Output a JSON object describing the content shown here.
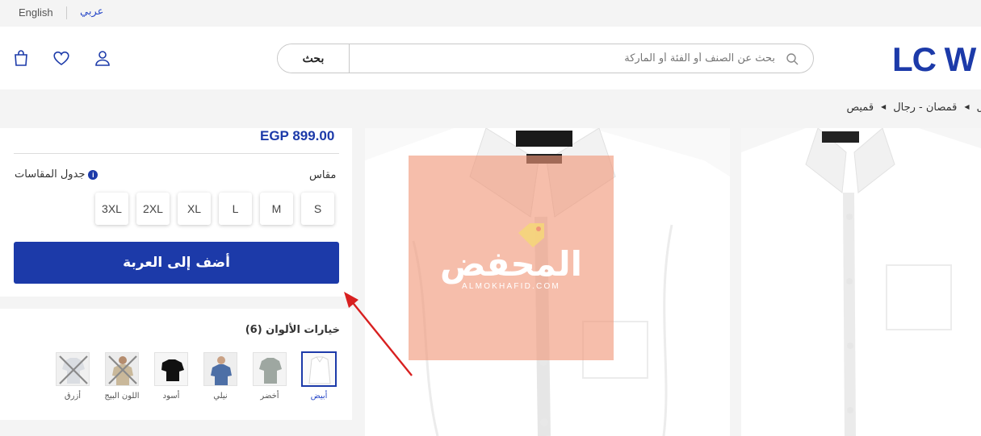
{
  "lang": {
    "english": "English",
    "arabic": "عربي"
  },
  "header": {
    "search_button": "بحث",
    "search_placeholder": "بحث عن الصنف أو الفئة أو الماركة",
    "logo_text": "LC W",
    "icons": [
      "cart-icon",
      "heart-icon",
      "user-icon",
      "search-icon"
    ]
  },
  "breadcrumb": [
    "قميص",
    "قمصان - رجال",
    "ل"
  ],
  "product": {
    "price": "EGP 899.00",
    "size_label": "مقاس",
    "size_chart_label": "جدول المقاسات",
    "sizes": [
      "S",
      "M",
      "L",
      "XL",
      "2XL",
      "3XL"
    ],
    "add_to_cart": "أضف إلى العربة"
  },
  "colors": {
    "title": "خيارات الألوان (6)",
    "options": [
      {
        "label": "أبيض",
        "selected": true,
        "swatch": "#ffffff"
      },
      {
        "label": "أخضر",
        "selected": false,
        "swatch": "#9ea7a1"
      },
      {
        "label": "نيلي",
        "selected": false,
        "swatch": "#4d6fa6"
      },
      {
        "label": "أسود",
        "selected": false,
        "swatch": "#111111"
      },
      {
        "label": "اللون البيج",
        "selected": false,
        "swatch": "#c9b89a"
      },
      {
        "label": "أزرق",
        "selected": false,
        "swatch": "#c8ccd2"
      }
    ]
  },
  "watermark": {
    "text": "المحفض",
    "subtext": "ALMOKHAFID.COM",
    "color": "#f09678"
  },
  "colors_theme": {
    "brand": "#1c3aa9",
    "annotation": "#d82020"
  }
}
